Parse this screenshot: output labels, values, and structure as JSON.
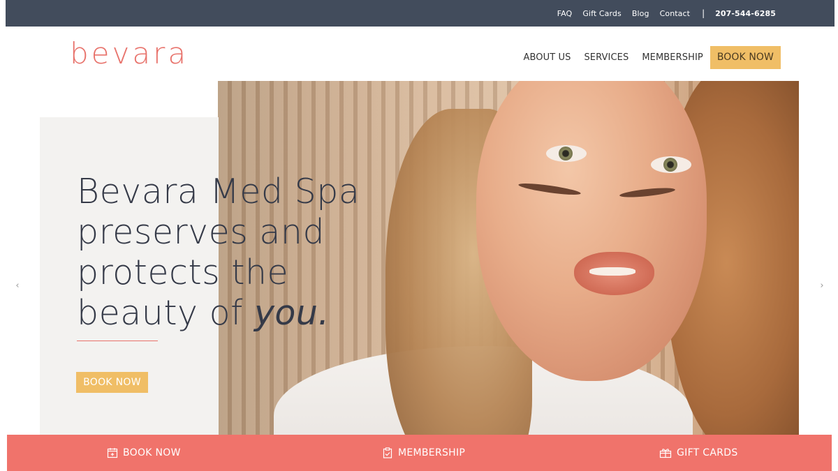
{
  "topbar": {
    "links": [
      "FAQ",
      "Gift Cards",
      "Blog",
      "Contact"
    ],
    "separator": "|",
    "phone": "207-544-6285"
  },
  "brand": {
    "logo": "bevara",
    "colors": {
      "coral": "#f0736b",
      "gold": "#f0be66",
      "slate": "#424c5c",
      "panel": "#f3f2f0"
    }
  },
  "nav": {
    "items": [
      "ABOUT US",
      "SERVICES",
      "MEMBERSHIP"
    ],
    "cta": "BOOK NOW"
  },
  "hero": {
    "headline_lines": [
      "Bevara Med Spa",
      "preserves and",
      "protects the",
      "beauty of "
    ],
    "headline_emphasis": "you.",
    "cta": "BOOK NOW",
    "prev_icon": "‹",
    "next_icon": "›"
  },
  "bottombar": {
    "items": [
      {
        "label": "BOOK NOW",
        "icon": "calendar-icon"
      },
      {
        "label": "MEMBERSHIP",
        "icon": "clipboard-check-icon"
      },
      {
        "label": "GIFT CARDS",
        "icon": "gift-icon"
      }
    ]
  }
}
